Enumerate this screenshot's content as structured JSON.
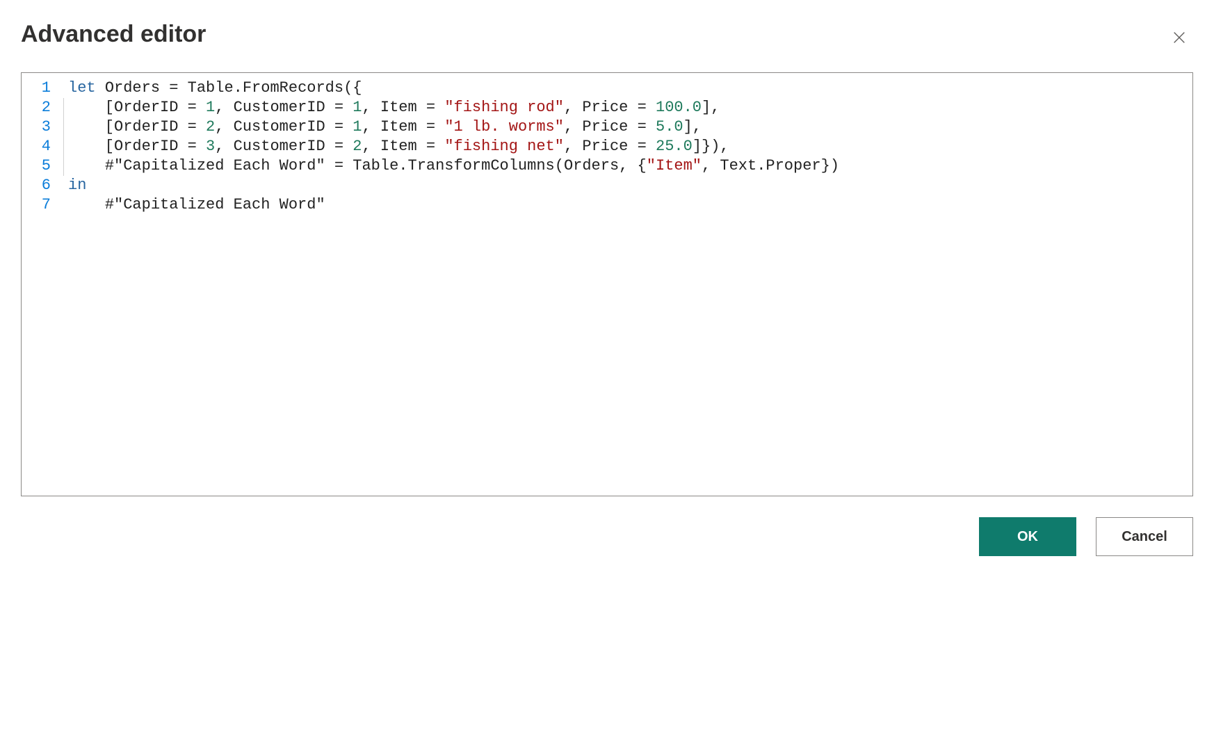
{
  "dialog": {
    "title": "Advanced editor",
    "close_aria": "Close"
  },
  "editor": {
    "lines": [
      [
        {
          "t": "kw",
          "v": "let"
        },
        {
          "t": "op",
          "v": " "
        },
        {
          "t": "id",
          "v": "Orders"
        },
        {
          "t": "op",
          "v": " = "
        },
        {
          "t": "id",
          "v": "Table.FromRecords"
        },
        {
          "t": "op",
          "v": "({"
        }
      ],
      [
        {
          "t": "op",
          "v": "    ["
        },
        {
          "t": "id",
          "v": "OrderID"
        },
        {
          "t": "op",
          "v": " = "
        },
        {
          "t": "num",
          "v": "1"
        },
        {
          "t": "op",
          "v": ", "
        },
        {
          "t": "id",
          "v": "CustomerID"
        },
        {
          "t": "op",
          "v": " = "
        },
        {
          "t": "num",
          "v": "1"
        },
        {
          "t": "op",
          "v": ", "
        },
        {
          "t": "id",
          "v": "Item"
        },
        {
          "t": "op",
          "v": " = "
        },
        {
          "t": "str",
          "v": "\"fishing rod\""
        },
        {
          "t": "op",
          "v": ", "
        },
        {
          "t": "id",
          "v": "Price"
        },
        {
          "t": "op",
          "v": " = "
        },
        {
          "t": "num",
          "v": "100.0"
        },
        {
          "t": "op",
          "v": "],"
        }
      ],
      [
        {
          "t": "op",
          "v": "    ["
        },
        {
          "t": "id",
          "v": "OrderID"
        },
        {
          "t": "op",
          "v": " = "
        },
        {
          "t": "num",
          "v": "2"
        },
        {
          "t": "op",
          "v": ", "
        },
        {
          "t": "id",
          "v": "CustomerID"
        },
        {
          "t": "op",
          "v": " = "
        },
        {
          "t": "num",
          "v": "1"
        },
        {
          "t": "op",
          "v": ", "
        },
        {
          "t": "id",
          "v": "Item"
        },
        {
          "t": "op",
          "v": " = "
        },
        {
          "t": "str",
          "v": "\"1 lb. worms\""
        },
        {
          "t": "op",
          "v": ", "
        },
        {
          "t": "id",
          "v": "Price"
        },
        {
          "t": "op",
          "v": " = "
        },
        {
          "t": "num",
          "v": "5.0"
        },
        {
          "t": "op",
          "v": "],"
        }
      ],
      [
        {
          "t": "op",
          "v": "    ["
        },
        {
          "t": "id",
          "v": "OrderID"
        },
        {
          "t": "op",
          "v": " = "
        },
        {
          "t": "num",
          "v": "3"
        },
        {
          "t": "op",
          "v": ", "
        },
        {
          "t": "id",
          "v": "CustomerID"
        },
        {
          "t": "op",
          "v": " = "
        },
        {
          "t": "num",
          "v": "2"
        },
        {
          "t": "op",
          "v": ", "
        },
        {
          "t": "id",
          "v": "Item"
        },
        {
          "t": "op",
          "v": " = "
        },
        {
          "t": "str",
          "v": "\"fishing net\""
        },
        {
          "t": "op",
          "v": ", "
        },
        {
          "t": "id",
          "v": "Price"
        },
        {
          "t": "op",
          "v": " = "
        },
        {
          "t": "num",
          "v": "25.0"
        },
        {
          "t": "op",
          "v": "]}),"
        }
      ],
      [
        {
          "t": "op",
          "v": "    "
        },
        {
          "t": "id",
          "v": "#\"Capitalized Each Word\""
        },
        {
          "t": "op",
          "v": " = "
        },
        {
          "t": "id",
          "v": "Table.TransformColumns"
        },
        {
          "t": "op",
          "v": "("
        },
        {
          "t": "id",
          "v": "Orders"
        },
        {
          "t": "op",
          "v": ", {"
        },
        {
          "t": "str",
          "v": "\"Item\""
        },
        {
          "t": "op",
          "v": ", "
        },
        {
          "t": "id",
          "v": "Text.Proper"
        },
        {
          "t": "op",
          "v": "})"
        }
      ],
      [
        {
          "t": "kw",
          "v": "in"
        }
      ],
      [
        {
          "t": "op",
          "v": "    "
        },
        {
          "t": "id",
          "v": "#\"Capitalized Each Word\""
        }
      ]
    ]
  },
  "footer": {
    "ok_label": "OK",
    "cancel_label": "Cancel"
  }
}
